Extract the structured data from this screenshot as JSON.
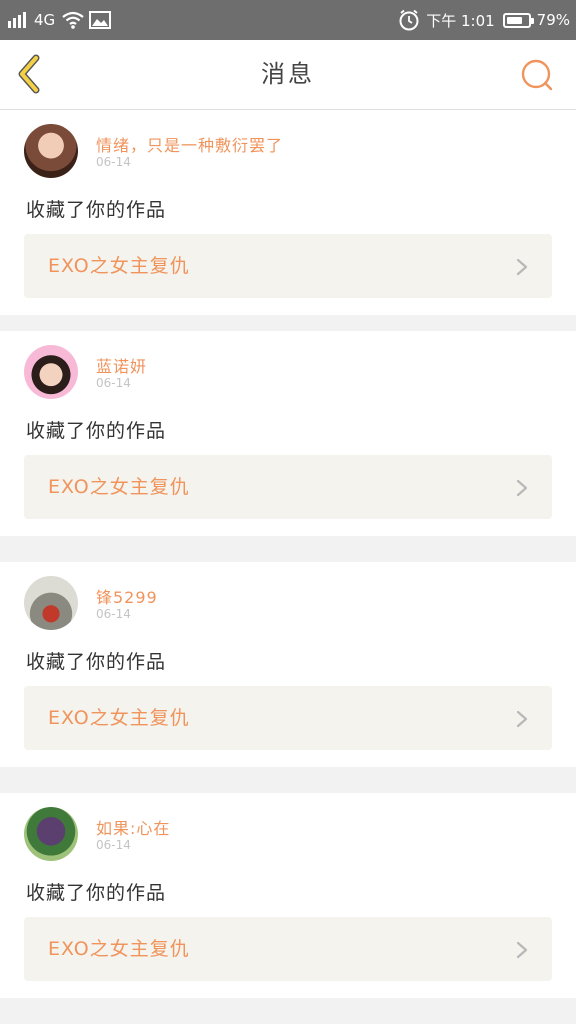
{
  "status_bar": {
    "network": "4G",
    "time": "下午 1:01",
    "battery": "79%",
    "battery_level": 0.79
  },
  "header": {
    "title": "消息",
    "back_icon": "chevron-left-icon",
    "search_icon": "search-icon"
  },
  "colors": {
    "accent": "#f0945c",
    "back_yellow": "#f3d046",
    "card_bg": "#f4f3ee"
  },
  "messages": [
    {
      "user": "情绪，只是一种敷衍罢了",
      "date": "06-14",
      "action": "收藏了你的作品",
      "work_title": "EXO之女主复仇",
      "avatar": "avatar-photo"
    },
    {
      "user": "蓝诺妍",
      "date": "06-14",
      "action": "收藏了你的作品",
      "work_title": "EXO之女主复仇",
      "avatar": "avatar-photo"
    },
    {
      "user": "锋5299",
      "date": "06-14",
      "action": "收藏了你的作品",
      "work_title": "EXO之女主复仇",
      "avatar": "avatar-photo"
    },
    {
      "user": "如果:心在",
      "date": "06-14",
      "action": "收藏了你的作品",
      "work_title": "EXO之女主复仇",
      "avatar": "avatar-photo"
    }
  ]
}
